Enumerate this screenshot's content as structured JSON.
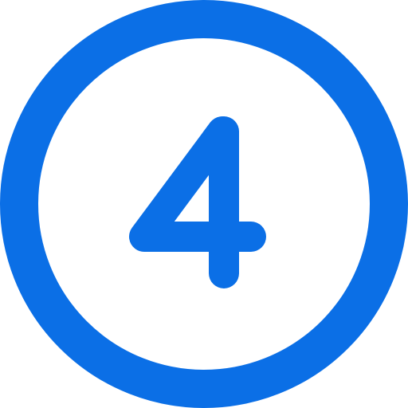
{
  "icon": {
    "name": "number-4-circle-icon",
    "label": "4",
    "color": "#0b6fe6",
    "background": "#ffffff"
  }
}
